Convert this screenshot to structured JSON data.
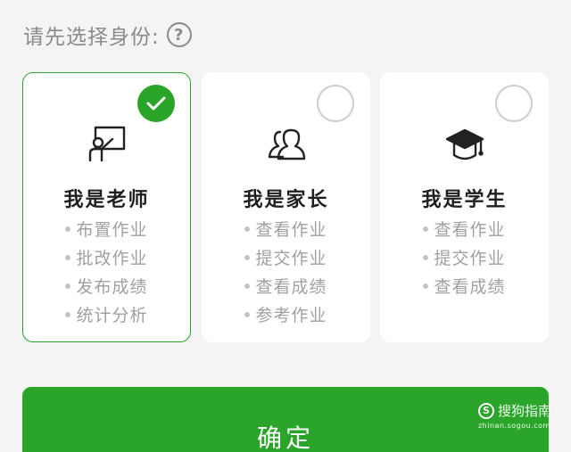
{
  "prompt": {
    "label": "请先选择身份:",
    "help_icon": "?"
  },
  "cards": [
    {
      "id": "teacher",
      "title": "我是老师",
      "icon": "teacher-icon",
      "selected": true,
      "features": [
        "布置作业",
        "批改作业",
        "发布成绩",
        "统计分析"
      ]
    },
    {
      "id": "parent",
      "title": "我是家长",
      "icon": "parents-icon",
      "selected": false,
      "features": [
        "查看作业",
        "提交作业",
        "查看成绩",
        "参考作业"
      ]
    },
    {
      "id": "student",
      "title": "我是学生",
      "icon": "graduation-cap-icon",
      "selected": false,
      "features": [
        "查看作业",
        "提交作业",
        "查看成绩"
      ]
    }
  ],
  "confirm": {
    "label": "确定"
  },
  "watermark": {
    "logo": "S",
    "text": "搜狗指南",
    "url": "zhinan.sogou.com"
  },
  "colors": {
    "accent": "#2aa52a",
    "muted": "#a0a0a0",
    "background": "#f4f4f4"
  }
}
